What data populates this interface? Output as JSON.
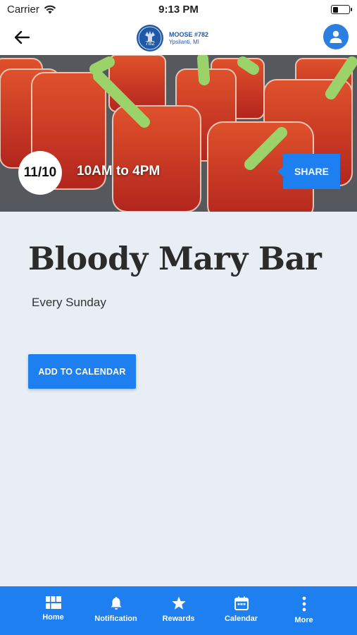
{
  "status": {
    "carrier": "Carrier",
    "time": "9:13 PM",
    "battery_level": 0.35
  },
  "header": {
    "logo_title": "MOOSE #782",
    "logo_subtitle": "Ypsilanti, MI",
    "logo_seal_text": "782"
  },
  "event": {
    "date": "11/10",
    "time_range": "10AM to 4PM",
    "share_label": "SHARE",
    "title": "Bloody Mary Bar",
    "recurrence": "Every Sunday",
    "add_to_calendar_label": "ADD TO CALENDAR"
  },
  "tabs": [
    {
      "label": "Home",
      "icon": "home-grid-icon"
    },
    {
      "label": "Notification",
      "icon": "bell-icon"
    },
    {
      "label": "Rewards",
      "icon": "star-icon"
    },
    {
      "label": "Calendar",
      "icon": "calendar-icon"
    },
    {
      "label": "More",
      "icon": "more-vertical-icon"
    }
  ],
  "colors": {
    "accent": "#1d7ff0",
    "background": "#e8eef4",
    "brand": "#1e5aa8"
  }
}
